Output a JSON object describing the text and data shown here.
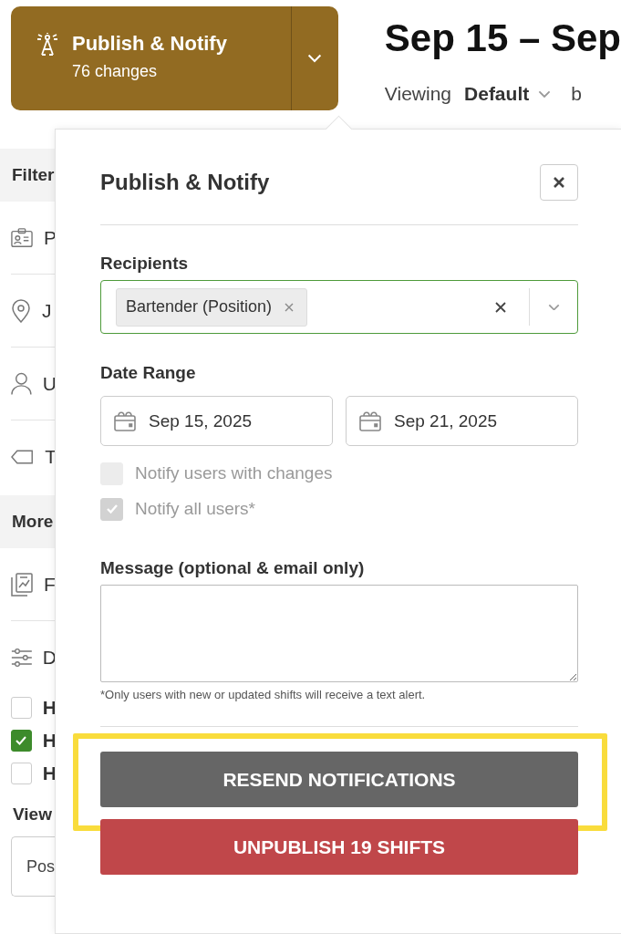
{
  "publish_button": {
    "title": "Publish & Notify",
    "subtitle": "76 changes"
  },
  "schedule": {
    "title": "Sep 15 – Sep",
    "viewing_label": "Viewing",
    "view": "Default",
    "next": "b"
  },
  "sidebar": {
    "filter_header": "Filter",
    "filters": [
      {
        "kind": "id-card",
        "label": "P"
      },
      {
        "kind": "pin",
        "label": "J"
      },
      {
        "kind": "person",
        "label": "U"
      },
      {
        "kind": "tag",
        "label": "T"
      }
    ],
    "more_header": "More",
    "more_items": [
      {
        "kind": "report",
        "label": "F"
      },
      {
        "kind": "sliders",
        "label": "D"
      }
    ],
    "checkboxes": [
      {
        "label": "H",
        "checked": false
      },
      {
        "label": "H",
        "checked": true
      },
      {
        "label": "H",
        "checked": false
      }
    ],
    "view_label": "View",
    "view_select": "Pos"
  },
  "popover": {
    "title": "Publish & Notify",
    "recipients_label": "Recipients",
    "recipients_focused": true,
    "recipients": [
      {
        "label": "Bartender (Position)"
      }
    ],
    "date_label": "Date Range",
    "dates": [
      "Sep 15, 2025",
      "Sep 21, 2025"
    ],
    "options": [
      {
        "label": "Notify users with changes",
        "checked": false,
        "disabled": true
      },
      {
        "label": "Notify all users*",
        "checked": true,
        "disabled": true
      }
    ],
    "message_label": "Message (optional & email only)",
    "footnote": "*Only users with new or updated shifts will receive a text alert.",
    "buttons": [
      {
        "kind": "resend",
        "label": "RESEND NOTIFICATIONS",
        "highlighted": true
      },
      {
        "kind": "unpublish",
        "label": "UNPUBLISH 19 SHIFTS",
        "highlighted": false
      }
    ]
  }
}
